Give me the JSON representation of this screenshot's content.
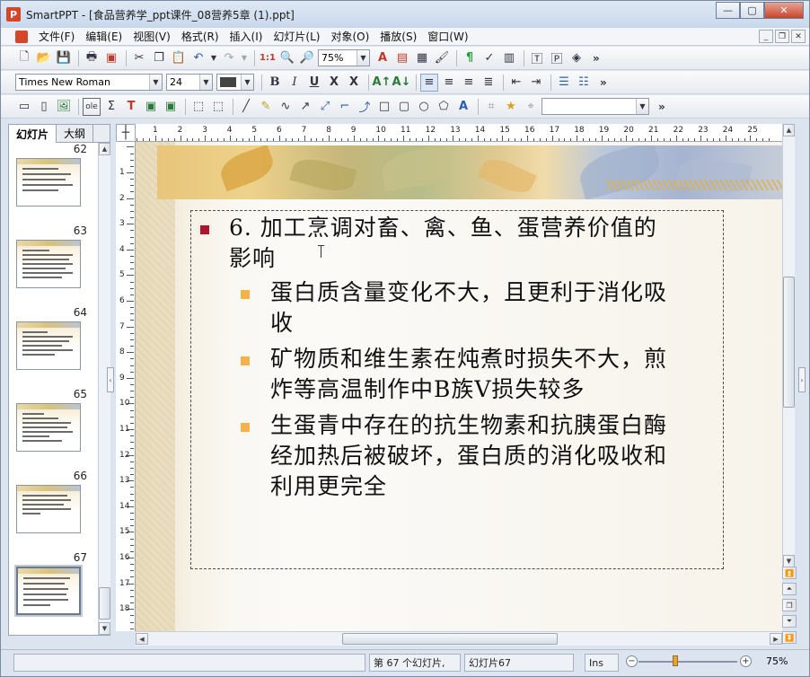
{
  "window": {
    "app_name": "SmartPPT",
    "title": "SmartPPT - [食品营养学_ppt课件_08营养5章 (1).ppt]",
    "controls": {
      "minimize": "—",
      "maximize": "▢",
      "close": "✕"
    }
  },
  "menu": {
    "items": [
      "文件(F)",
      "编辑(E)",
      "视图(V)",
      "格式(R)",
      "插入(I)",
      "幻灯片(L)",
      "对象(O)",
      "播放(S)",
      "窗口(W)"
    ],
    "mdi_controls": {
      "minimize": "_",
      "restore": "❐",
      "close": "✕"
    }
  },
  "toolbar_standard": {
    "zoom_value": "75%"
  },
  "toolbar_format": {
    "font_name": "Times New Roman",
    "font_size": "24",
    "bold": "B",
    "italic": "I",
    "underline": "U",
    "strike": "X",
    "x2": "X"
  },
  "toolbar_draw": {
    "shape_combo_value": ""
  },
  "left_panel": {
    "tabs": [
      "幻灯片",
      "大纲"
    ],
    "active_tab": "幻灯片",
    "thumbnails": [
      {
        "number": "62"
      },
      {
        "number": "63"
      },
      {
        "number": "64"
      },
      {
        "number": "65"
      },
      {
        "number": "66"
      },
      {
        "number": "67",
        "selected": true
      }
    ]
  },
  "rulers": {
    "horizontal": [
      "1",
      "2",
      "3",
      "4",
      "5",
      "6",
      "7",
      "8",
      "9",
      "10",
      "11",
      "12",
      "13",
      "14",
      "15",
      "16",
      "17",
      "18",
      "19",
      "20",
      "21",
      "22",
      "23",
      "24",
      "25"
    ],
    "vertical": [
      "1",
      "2",
      "3",
      "4",
      "5",
      "6",
      "7",
      "8",
      "9",
      "10",
      "11",
      "12",
      "13",
      "14",
      "15",
      "16",
      "17",
      "18"
    ]
  },
  "slide": {
    "heading": {
      "line1": "6. 加工烹调对畜、禽、鱼、蛋营养价值的",
      "line2": "影响"
    },
    "bullets": [
      {
        "line1": "蛋白质含量变化不大，且更利于消化吸",
        "line2": "收"
      },
      {
        "line1": "矿物质和维生素在炖煮时损失不大，煎",
        "line2": "炸等高温制作中B族V损失较多"
      },
      {
        "line1": "生蛋青中存在的抗生物素和抗胰蛋白酶",
        "line2": "经加热后被破坏，蛋白质的消化吸收和",
        "line3": "利用更完全"
      }
    ],
    "colors": {
      "bullet_l1": "#b3122c",
      "bullet_l2": "#f5b24a"
    }
  },
  "statusbar": {
    "slide_count": "第 67 个幻灯片,",
    "current_slide": "幻灯片67",
    "mode": "Ins",
    "zoom": "75%",
    "zoom_minus": "−",
    "zoom_plus": "+"
  }
}
